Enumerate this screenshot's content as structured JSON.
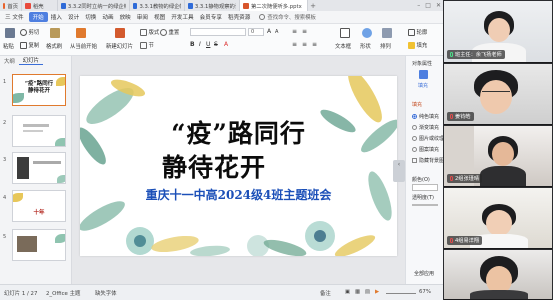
{
  "tabs": [
    {
      "label": "首页",
      "color": "#e8622c"
    },
    {
      "label": "稻壳",
      "color": "#e84a3c"
    },
    {
      "label": "3.3.2同时立纳一的绿企幅问题",
      "color": "#2f6bd8"
    },
    {
      "label": "3.3.1教物的绿企幅问题",
      "color": "#2f6bd8"
    },
    {
      "label": "3.3.1静物观察的详情",
      "color": "#2f6bd8"
    },
    {
      "label": "第二次随便听多.pptx",
      "color": "#d8562c"
    }
  ],
  "tab_add": "+",
  "menu": {
    "file": "三 文件",
    "items": [
      "开始",
      "插入",
      "设计",
      "切换",
      "动画",
      "放映",
      "审阅",
      "视图",
      "开发工具",
      "会员专享",
      "稻壳资源"
    ],
    "search": "查找命令、搜索模板"
  },
  "ribbon": {
    "paste": "粘贴",
    "cut": "剪切",
    "copy": "复制",
    "format_painter": "格式刷",
    "from_current": "从当前开始",
    "new_slide": "新建幻灯片",
    "layout": "版式",
    "section": "节",
    "reset": "重置",
    "font_size": "0",
    "text_box": "文本框",
    "shape": "形状",
    "arrange": "排列",
    "outline": "轮廓",
    "fill": "填充"
  },
  "left_panel": {
    "tab_outline": "大纲",
    "tab_slides": "幻灯片",
    "thumb1_line1": "“疫”路同行",
    "thumb1_line2": "静待花开",
    "thumb4_text": "十年",
    "add_slide": "+"
  },
  "slide": {
    "title_line1": "“疫”路同行",
    "title_line2": "静待花开",
    "subtitle": "重庆十一中高2024级4班主题班会"
  },
  "task_pane": {
    "header": "对象属性",
    "fill_section": "填充",
    "fill_tab": "填充",
    "options": [
      "纯色填充",
      "渐变填充",
      "图片或纹理填充",
      "图案填充",
      "隐藏背景图形"
    ],
    "color_label": "颜色(O)",
    "transparency_label": "透明度(T)",
    "apply_all": "全部应用"
  },
  "status_bar": {
    "slide_info": "幻灯片 1 / 27",
    "theme": "2_Office 主题",
    "missing_font": "缺失字体",
    "notes": "备注",
    "zoom": "67%"
  },
  "participants": [
    {
      "name": "班主任：余飞扬老师",
      "mic": "on"
    },
    {
      "name": "姜钧皓",
      "mic": "off"
    },
    {
      "name": "2组张瑾晴",
      "mic": "off"
    },
    {
      "name": "4组易洋翔",
      "mic": "off"
    },
    {
      "name": "",
      "mic": "off"
    }
  ],
  "colors": {
    "accent": "#4e7fe0",
    "selected_thumb": "#e07a2e",
    "subtitle": "#1b4fb8",
    "video_bg": "#2a2b2e"
  }
}
